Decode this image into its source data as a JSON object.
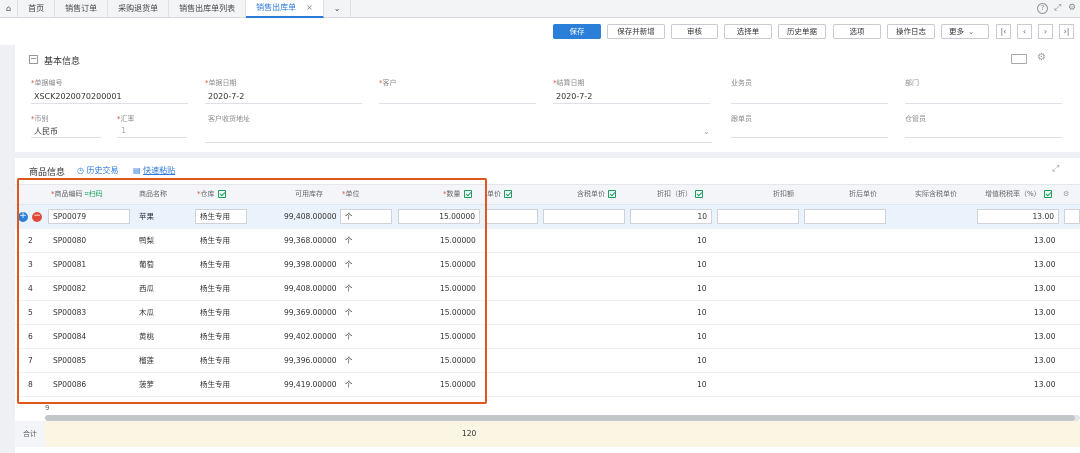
{
  "tabs": [
    {
      "label": "首页",
      "active": false,
      "closable": false
    },
    {
      "label": "销售订单",
      "active": false,
      "closable": false
    },
    {
      "label": "采购退货单",
      "active": false,
      "closable": false
    },
    {
      "label": "销售出库单列表",
      "active": false,
      "closable": false
    },
    {
      "label": "销售出库单",
      "active": true,
      "closable": true
    }
  ],
  "toolbar": {
    "save": "保存",
    "save_new": "保存并新增",
    "audit": "审核",
    "select": "选择单",
    "history": "历史单据",
    "options": "选项",
    "log": "操作日志",
    "more": "更多"
  },
  "basic": {
    "title": "基本信息",
    "doc_no_label": "单据编号",
    "doc_no": "XSCK2020070200001",
    "doc_date_label": "单据日期",
    "doc_date": "2020-7-2",
    "customer_label": "客户",
    "settle_date_label": "结算日期",
    "settle_date": "2020-7-2",
    "salesman_label": "业务员",
    "dept_label": "部门",
    "currency_label": "币别",
    "currency": "人民币",
    "rate_label": "汇率",
    "rate": "1",
    "address_label": "客户收货地址",
    "follower_label": "跟单员",
    "keeper_label": "仓管员"
  },
  "goods": {
    "title": "商品信息",
    "history_link": "历史交易",
    "paste_link": "快速粘贴",
    "scan": "扫码",
    "columns": {
      "code": "商品编码",
      "name": "商品名称",
      "warehouse": "仓库",
      "stock": "可用库存",
      "unit": "单位",
      "qty": "数量",
      "price": "单价",
      "tax_price": "含税单价",
      "discount": "折扣（折）",
      "disc_amt": "折扣额",
      "after_price": "折后单价",
      "tax_after": "实际含税单价",
      "vat": "增值税税率（%）"
    },
    "rows": [
      {
        "idx": "",
        "code": "SP00079",
        "name": "苹果",
        "wh": "杨生专用",
        "stock": "99,408.00000",
        "unit": "个",
        "qty": "15.00000",
        "discount": "10",
        "vat": "13.00"
      },
      {
        "idx": "2",
        "code": "SP00080",
        "name": "鸭梨",
        "wh": "杨生专用",
        "stock": "99,368.00000",
        "unit": "个",
        "qty": "15.00000",
        "discount": "10",
        "vat": "13.00"
      },
      {
        "idx": "3",
        "code": "SP00081",
        "name": "葡萄",
        "wh": "杨生专用",
        "stock": "99,398.00000",
        "unit": "个",
        "qty": "15.00000",
        "discount": "10",
        "vat": "13.00"
      },
      {
        "idx": "4",
        "code": "SP00082",
        "name": "西瓜",
        "wh": "杨生专用",
        "stock": "99,408.00000",
        "unit": "个",
        "qty": "15.00000",
        "discount": "10",
        "vat": "13.00"
      },
      {
        "idx": "5",
        "code": "SP00083",
        "name": "木瓜",
        "wh": "杨生专用",
        "stock": "99,369.00000",
        "unit": "个",
        "qty": "15.00000",
        "discount": "10",
        "vat": "13.00"
      },
      {
        "idx": "6",
        "code": "SP00084",
        "name": "黄桃",
        "wh": "杨生专用",
        "stock": "99,402.00000",
        "unit": "个",
        "qty": "15.00000",
        "discount": "10",
        "vat": "13.00"
      },
      {
        "idx": "7",
        "code": "SP00085",
        "name": "榴莲",
        "wh": "杨生专用",
        "stock": "99,396.00000",
        "unit": "个",
        "qty": "15.00000",
        "discount": "10",
        "vat": "13.00"
      },
      {
        "idx": "8",
        "code": "SP00086",
        "name": "菠萝",
        "wh": "杨生专用",
        "stock": "99,419.00000",
        "unit": "个",
        "qty": "15.00000",
        "discount": "10",
        "vat": "13.00"
      }
    ],
    "last_idx": "9",
    "total_label": "合计",
    "total_qty": "120"
  },
  "colors": {
    "primary": "#2b7fd8",
    "highlight": "#e0561f",
    "required": "#e04a3a",
    "check": "#19a05a"
  }
}
